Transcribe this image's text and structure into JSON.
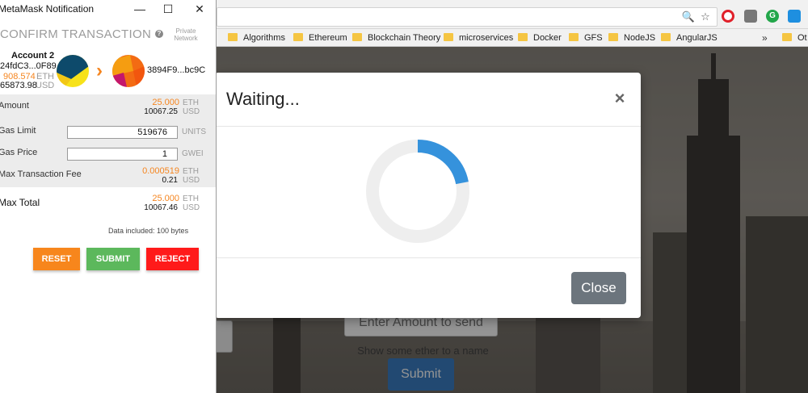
{
  "browser": {
    "bookmarks": [
      "Algorithms",
      "Ethereum",
      "Blockchain Theory",
      "microservices",
      "Docker",
      "GFS",
      "NodeJS",
      "AngularJS",
      "Ot"
    ],
    "overflow_label": "»"
  },
  "page": {
    "amount_placeholder": "Enter Amount to send",
    "show_label": "Show some ether to a name",
    "submit_label": "Submit"
  },
  "modal": {
    "title": "Waiting...",
    "close_x": "×",
    "close_label": "Close",
    "spinner_progress": 0.22
  },
  "metamask": {
    "window_title": "MetaMask Notification",
    "heading": "CONFIRM TRANSACTION",
    "network_label": "Private Network",
    "account": {
      "name": "Account 2",
      "address": "24fdC3...0F89",
      "balance": "908.574",
      "balance_unit": "ETH",
      "balance_usd": "65873.98",
      "balance_usd_unit": "USD"
    },
    "recipient": "3894F9...bc9C",
    "amount": {
      "label": "Amount",
      "eth": "25.000",
      "eth_unit": "ETH",
      "usd": "10067.25",
      "usd_unit": "USD"
    },
    "gas_limit": {
      "label": "Gas Limit",
      "value": "519676",
      "unit": "UNITS"
    },
    "gas_price": {
      "label": "Gas Price",
      "value": "1",
      "unit": "GWEI"
    },
    "max_fee": {
      "label": "Max Transaction Fee",
      "eth": "0.000519",
      "eth_unit": "ETH",
      "usd": "0.21",
      "usd_unit": "USD"
    },
    "max_total": {
      "label": "Max Total",
      "eth": "25.000",
      "eth_unit": "ETH",
      "usd": "10067.46",
      "usd_unit": "USD"
    },
    "data_included": "Data included: 100 bytes",
    "buttons": {
      "reset": "RESET",
      "submit": "SUBMIT",
      "reject": "REJECT"
    },
    "colors": {
      "reset": "#f7861c",
      "submit": "#5cb85c",
      "reject": "#ff1a1a",
      "accent": "#f5851f"
    }
  }
}
